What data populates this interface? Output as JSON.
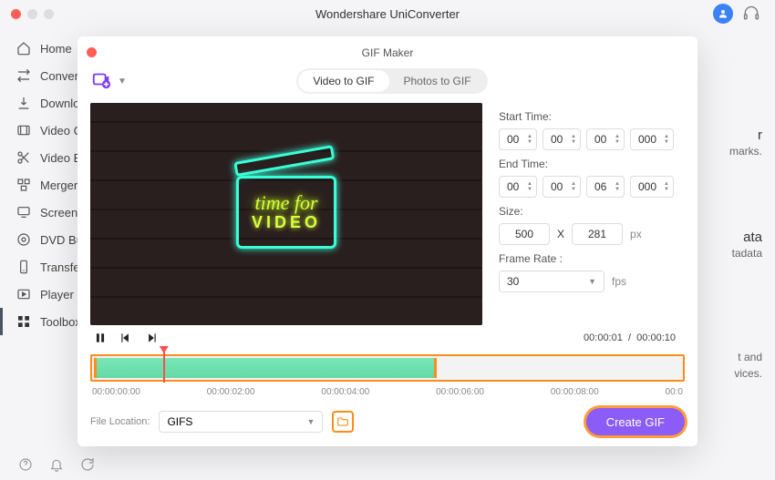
{
  "app": {
    "title": "Wondershare UniConverter"
  },
  "avatar": {
    "initial": ""
  },
  "sidebar": {
    "items": [
      {
        "icon": "home",
        "label": "Home"
      },
      {
        "icon": "convert",
        "label": "Convert"
      },
      {
        "icon": "download",
        "label": "Downloa"
      },
      {
        "icon": "videoc",
        "label": "Video C"
      },
      {
        "icon": "scissors",
        "label": "Video E"
      },
      {
        "icon": "merger",
        "label": "Merger"
      },
      {
        "icon": "screen",
        "label": "Screen"
      },
      {
        "icon": "dvd",
        "label": "DVD Bu"
      },
      {
        "icon": "transfer",
        "label": "Transfer"
      },
      {
        "icon": "player",
        "label": "Player"
      },
      {
        "icon": "toolbox",
        "label": "Toolbox"
      }
    ],
    "active_index": 10
  },
  "background_cards": {
    "card1": {
      "title_fragment": "r",
      "desc_fragment": "marks."
    },
    "card2": {
      "title_fragment": "ata",
      "desc_fragment": "tadata"
    },
    "card3": {
      "desc_fragment_a": "t and",
      "desc_fragment_b": "vices."
    }
  },
  "modal": {
    "title": "GIF Maker",
    "tabs": {
      "video": "Video to GIF",
      "photos": "Photos to GIF",
      "active": "video"
    },
    "preview": {
      "line1": "time for",
      "line2": "VIDEO"
    },
    "settings": {
      "start_label": "Start Time:",
      "start": {
        "h": "00",
        "m": "00",
        "s": "00",
        "ms": "000"
      },
      "end_label": "End Time:",
      "end": {
        "h": "00",
        "m": "00",
        "s": "06",
        "ms": "000"
      },
      "size_label": "Size:",
      "size": {
        "w": "500",
        "x_label": "X",
        "h": "281",
        "unit": "px"
      },
      "fr_label": "Frame Rate :",
      "fr_value": "30",
      "fr_unit": "fps"
    },
    "playback": {
      "current": "00:00:01",
      "sep": "/",
      "total": "00:00:10"
    },
    "ticks": [
      "00:00:00:00",
      "00:00:02:00",
      "00:00:04:00",
      "00:00:06:00",
      "00:00:08:00",
      "00:0"
    ],
    "footer": {
      "location_label": "File Location:",
      "location_value": "GIFS",
      "create_label": "Create GIF"
    }
  }
}
